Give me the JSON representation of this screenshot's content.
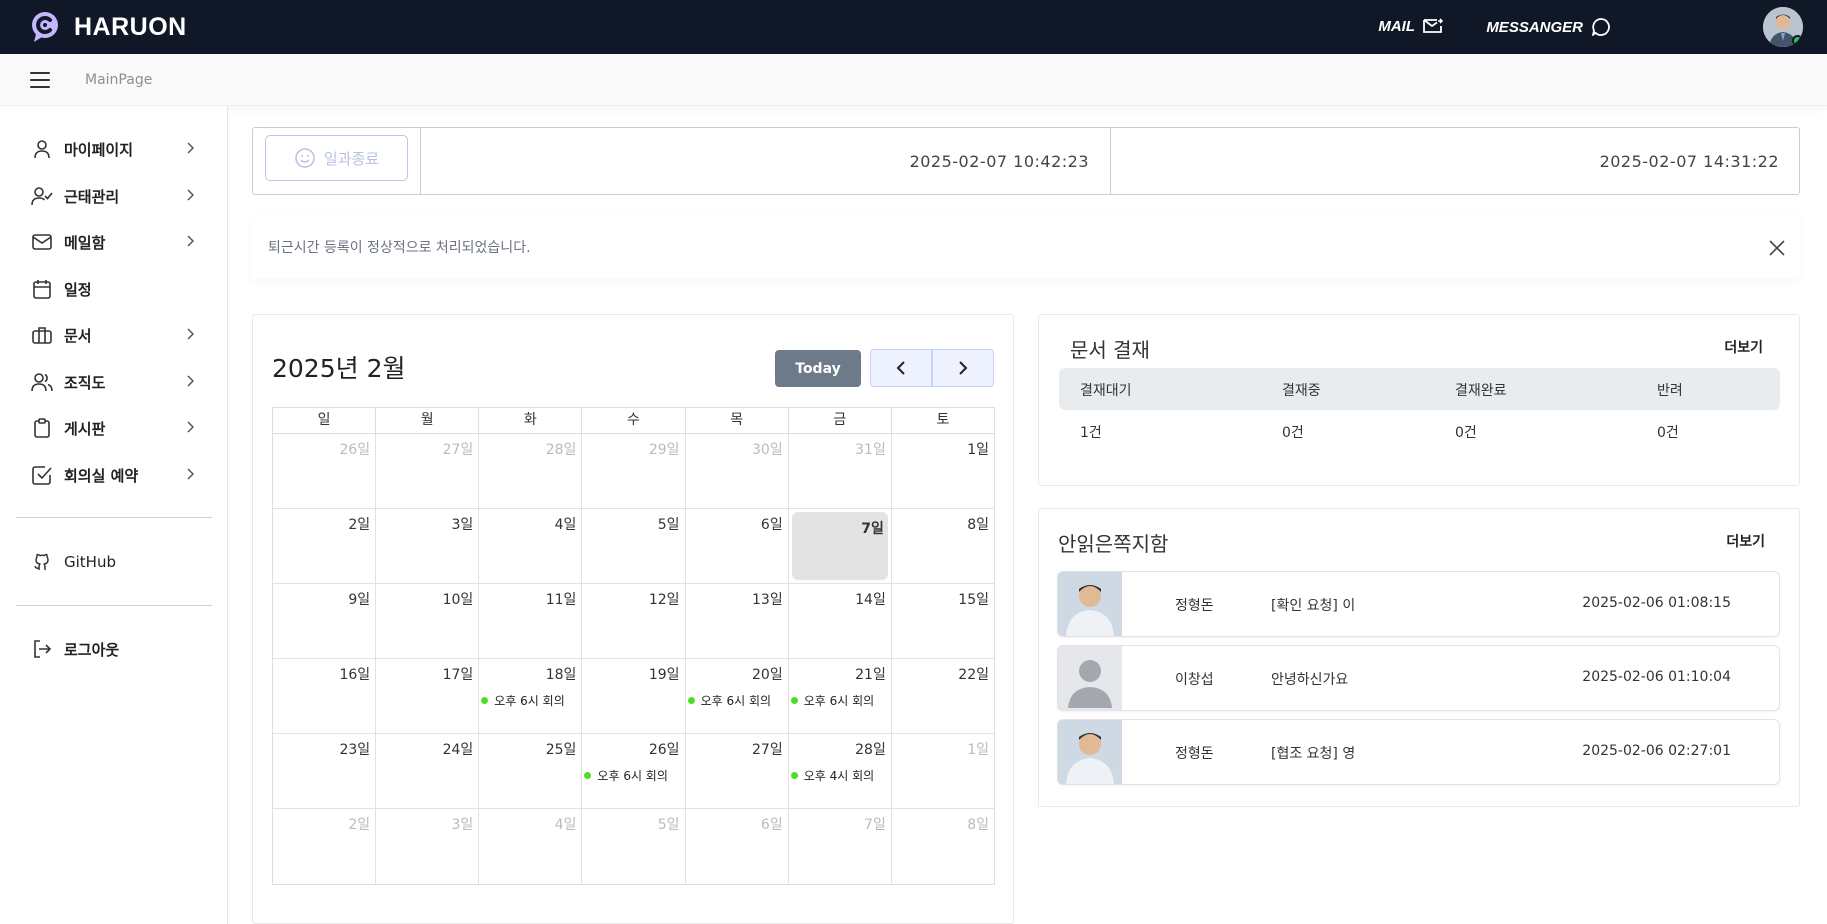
{
  "header": {
    "brand": "HARUON",
    "mail_label": "MAIL",
    "messenger_label": "MESSANGER"
  },
  "subheader": {
    "breadcrumb": "MainPage"
  },
  "sidebar": {
    "items": [
      {
        "label": "마이페이지",
        "icon": "user-icon",
        "has_chevron": true
      },
      {
        "label": "근태관리",
        "icon": "user-check-icon",
        "has_chevron": true
      },
      {
        "label": "메일함",
        "icon": "mail-icon",
        "has_chevron": true
      },
      {
        "label": "일정",
        "icon": "calendar-icon",
        "has_chevron": false
      },
      {
        "label": "문서",
        "icon": "briefcase-icon",
        "has_chevron": true
      },
      {
        "label": "조직도",
        "icon": "users-icon",
        "has_chevron": true
      },
      {
        "label": "게시판",
        "icon": "clipboard-icon",
        "has_chevron": true
      },
      {
        "label": "회의실 예약",
        "icon": "check-square-icon",
        "has_chevron": true
      }
    ],
    "github_label": "GitHub",
    "logout_label": "로그아웃"
  },
  "attendance": {
    "end_button_label": "일과종료",
    "clock_in_time": "2025-02-07 10:42:23",
    "clock_out_time": "2025-02-07 14:31:22"
  },
  "alert": {
    "message": "퇴근시간 등록이 정상적으로 처리되었습니다."
  },
  "calendar": {
    "title": "2025년 2월",
    "today_label": "Today",
    "weekdays": [
      "일",
      "월",
      "화",
      "수",
      "목",
      "금",
      "토"
    ],
    "weeks": [
      [
        {
          "d": "26일",
          "o": true
        },
        {
          "d": "27일",
          "o": true
        },
        {
          "d": "28일",
          "o": true
        },
        {
          "d": "29일",
          "o": true
        },
        {
          "d": "30일",
          "o": true
        },
        {
          "d": "31일",
          "o": true
        },
        {
          "d": "1일"
        }
      ],
      [
        {
          "d": "2일"
        },
        {
          "d": "3일"
        },
        {
          "d": "4일"
        },
        {
          "d": "5일"
        },
        {
          "d": "6일"
        },
        {
          "d": "7일",
          "today": true
        },
        {
          "d": "8일"
        }
      ],
      [
        {
          "d": "9일"
        },
        {
          "d": "10일"
        },
        {
          "d": "11일"
        },
        {
          "d": "12일"
        },
        {
          "d": "13일"
        },
        {
          "d": "14일"
        },
        {
          "d": "15일"
        }
      ],
      [
        {
          "d": "16일"
        },
        {
          "d": "17일"
        },
        {
          "d": "18일",
          "ev": "오후 6시 회의"
        },
        {
          "d": "19일"
        },
        {
          "d": "20일",
          "ev": "오후 6시 회의"
        },
        {
          "d": "21일",
          "ev": "오후 6시 회의"
        },
        {
          "d": "22일"
        }
      ],
      [
        {
          "d": "23일"
        },
        {
          "d": "24일"
        },
        {
          "d": "25일"
        },
        {
          "d": "26일",
          "ev": "오후 6시 회의"
        },
        {
          "d": "27일"
        },
        {
          "d": "28일",
          "ev": "오후 4시 회의"
        },
        {
          "d": "1일",
          "o": true
        }
      ],
      [
        {
          "d": "2일",
          "o": true
        },
        {
          "d": "3일",
          "o": true
        },
        {
          "d": "4일",
          "o": true
        },
        {
          "d": "5일",
          "o": true
        },
        {
          "d": "6일",
          "o": true
        },
        {
          "d": "7일",
          "o": true
        },
        {
          "d": "8일",
          "o": true
        }
      ]
    ],
    "event_color": "#4ade29"
  },
  "doc_approval": {
    "title": "문서 결재",
    "more_label": "더보기",
    "headers": [
      "결재대기",
      "결재중",
      "결재완료",
      "반려"
    ],
    "values": [
      "1건",
      "0건",
      "0건",
      "0건"
    ]
  },
  "unread_messages": {
    "title": "안읽은쪽지함",
    "more_label": "더보기",
    "rows": [
      {
        "sender": "정형돈",
        "subject": "[확인 요청] 이",
        "time": "2025-02-06 01:08:15",
        "avatar": "photo"
      },
      {
        "sender": "이창섭",
        "subject": "안녕하신가요",
        "time": "2025-02-06 01:10:04",
        "avatar": "default"
      },
      {
        "sender": "정형돈",
        "subject": "[협조 요청] 영",
        "time": "2025-02-06 02:27:01",
        "avatar": "photo"
      }
    ]
  },
  "colors": {
    "topbar": "#101828",
    "today_button": "#6c7a89",
    "online_status": "#22c55e"
  }
}
